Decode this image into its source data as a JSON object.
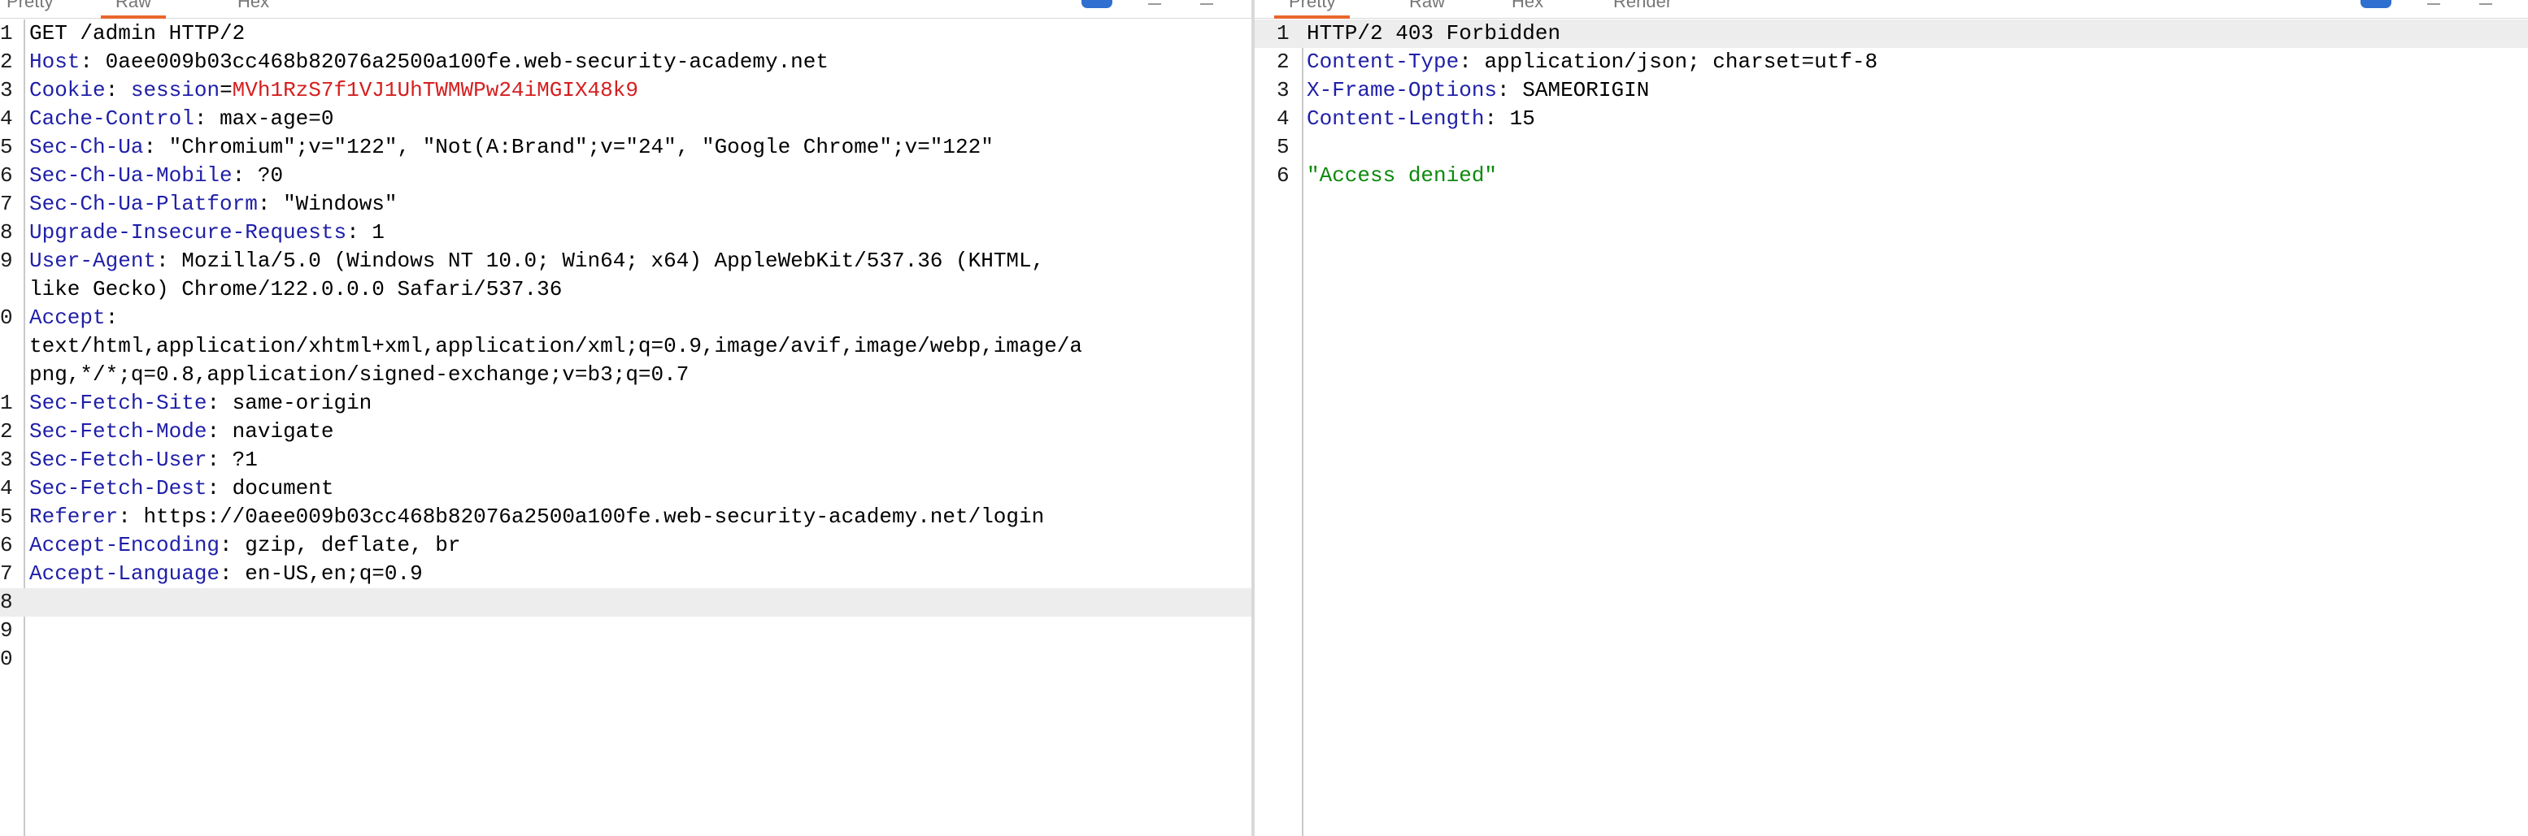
{
  "request": {
    "tabs": [
      "Pretty",
      "Raw",
      "Hex"
    ],
    "active_tab": "Raw",
    "line_numbers": [
      "1",
      "2",
      "3",
      "4",
      "5",
      "6",
      "7",
      "8",
      "9",
      "",
      "0",
      "",
      "",
      "1",
      "2",
      "3",
      "4",
      "5",
      "6",
      "7",
      "8",
      "9",
      "0"
    ],
    "lines": [
      {
        "key": "",
        "sep": "",
        "value": "GET /admin HTTP/2"
      },
      {
        "key": "Host",
        "sep": ": ",
        "value": "0aee009b03cc468b82076a2500a100fe.web-security-academy.net"
      },
      {
        "key": "Cookie",
        "sep": ": ",
        "cookie_name": "session",
        "cookie_eq": "=",
        "cookie_value": "MVh1RzS7f1VJ1UhTWMWPw24iMGIX48k9"
      },
      {
        "key": "Cache-Control",
        "sep": ": ",
        "value": "max-age=0"
      },
      {
        "key": "Sec-Ch-Ua",
        "sep": ": ",
        "value": "\"Chromium\";v=\"122\", \"Not(A:Brand\";v=\"24\", \"Google Chrome\";v=\"122\""
      },
      {
        "key": "Sec-Ch-Ua-Mobile",
        "sep": ": ",
        "value": "?0"
      },
      {
        "key": "Sec-Ch-Ua-Platform",
        "sep": ": ",
        "value": "\"Windows\""
      },
      {
        "key": "Upgrade-Insecure-Requests",
        "sep": ": ",
        "value": "1"
      },
      {
        "key": "User-Agent",
        "sep": ": ",
        "value": "Mozilla/5.0 (Windows NT 10.0; Win64; x64) AppleWebKit/537.36 (KHTML,"
      },
      {
        "key": "",
        "sep": "",
        "value": "like Gecko) Chrome/122.0.0.0 Safari/537.36"
      },
      {
        "key": "Accept",
        "sep": ":",
        "value": ""
      },
      {
        "key": "",
        "sep": "",
        "value": "text/html,application/xhtml+xml,application/xml;q=0.9,image/avif,image/webp,image/a"
      },
      {
        "key": "",
        "sep": "",
        "value": "png,*/*;q=0.8,application/signed-exchange;v=b3;q=0.7"
      },
      {
        "key": "Sec-Fetch-Site",
        "sep": ": ",
        "value": "same-origin"
      },
      {
        "key": "Sec-Fetch-Mode",
        "sep": ": ",
        "value": "navigate"
      },
      {
        "key": "Sec-Fetch-User",
        "sep": ": ",
        "value": "?1"
      },
      {
        "key": "Sec-Fetch-Dest",
        "sep": ": ",
        "value": "document"
      },
      {
        "key": "Referer",
        "sep": ": ",
        "value": "https://0aee009b03cc468b82076a2500a100fe.web-security-academy.net/login"
      },
      {
        "key": "Accept-Encoding",
        "sep": ": ",
        "value": "gzip, deflate, br"
      },
      {
        "key": "Accept-Language",
        "sep": ": ",
        "value": "en-US,en;q=0.9"
      },
      {
        "key": "",
        "sep": "",
        "value": ""
      },
      {
        "key": "",
        "sep": "",
        "value": ""
      },
      {
        "key": "",
        "sep": "",
        "value": ""
      }
    ]
  },
  "response": {
    "tabs": [
      "Pretty",
      "Raw",
      "Hex",
      "Render"
    ],
    "active_tab": "Pretty",
    "line_numbers": [
      "1",
      "2",
      "3",
      "4",
      "5",
      "6"
    ],
    "lines": [
      {
        "key": "",
        "sep": "",
        "value": "HTTP/2 403 Forbidden"
      },
      {
        "key": "Content-Type",
        "sep": ": ",
        "value": "application/json; charset=utf-8"
      },
      {
        "key": "X-Frame-Options",
        "sep": ": ",
        "value": "SAMEORIGIN"
      },
      {
        "key": "Content-Length",
        "sep": ": ",
        "value": "15"
      },
      {
        "key": "",
        "sep": "",
        "value": ""
      },
      {
        "key": "",
        "sep": "",
        "value": "\"Access denied\""
      }
    ]
  },
  "colors": {
    "accent": "#e9662c",
    "header_key": "#1f1fa8",
    "cookie": "#d61e1e",
    "json_string": "#0c8a0c",
    "blue_icon": "#2f6fcf"
  }
}
